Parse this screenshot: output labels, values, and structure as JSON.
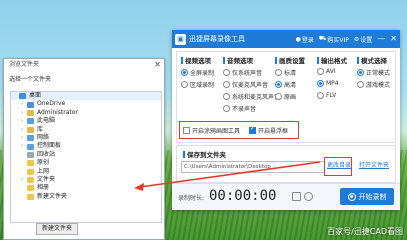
{
  "colors": {
    "accent": "#1e7bd8",
    "highlight": "#e23b2e"
  },
  "dialog": {
    "title": "浏览文件夹",
    "close_icon": "close-icon",
    "prompt": "选择一个文件夹",
    "tree": [
      {
        "label": "桌面",
        "icon": "desktop-icon",
        "color": "#3a8ee6",
        "indent": 0,
        "expander": ""
      },
      {
        "label": "OneDrive",
        "icon": "cloud-icon",
        "color": "#4a90d9",
        "indent": 1,
        "expander": "›"
      },
      {
        "label": "Administrator",
        "icon": "user-folder-icon",
        "color": "#e6b84a",
        "indent": 1,
        "expander": "›"
      },
      {
        "label": "此电脑",
        "icon": "computer-icon",
        "color": "#5aa0e0",
        "indent": 1,
        "expander": "›"
      },
      {
        "label": "库",
        "icon": "library-icon",
        "color": "#e6b84a",
        "indent": 1,
        "expander": "›"
      },
      {
        "label": "网络",
        "icon": "network-icon",
        "color": "#5aa0e0",
        "indent": 1,
        "expander": "›"
      },
      {
        "label": "控制面板",
        "icon": "control-panel-icon",
        "color": "#5aa0e0",
        "indent": 1,
        "expander": "›"
      },
      {
        "label": "回收站",
        "icon": "recycle-bin-icon",
        "color": "#9aa",
        "indent": 1,
        "expander": ""
      },
      {
        "label": "原创",
        "icon": "folder-icon",
        "color": "#f0c64e",
        "indent": 1,
        "expander": ""
      },
      {
        "label": "上网",
        "icon": "folder-icon",
        "color": "#f0c64e",
        "indent": 1,
        "expander": ""
      },
      {
        "label": "文件夹",
        "icon": "folder-icon",
        "color": "#f0c64e",
        "indent": 1,
        "expander": "›"
      },
      {
        "label": "相册",
        "icon": "folder-icon",
        "color": "#f0c64e",
        "indent": 1,
        "expander": ""
      },
      {
        "label": "新建文件夹",
        "icon": "folder-icon",
        "color": "#f0c64e",
        "indent": 1,
        "expander": ""
      }
    ],
    "new_folder_button": "新建文件夹"
  },
  "app": {
    "title": "迅捷屏幕录像工具",
    "header": {
      "login": "登录",
      "buy_vip": "购买VIP",
      "settings": "设置",
      "minimize": "—",
      "close": "✕"
    },
    "columns": {
      "video": {
        "title": "视频选项",
        "options": [
          {
            "label": "全屏录制",
            "selected": true
          },
          {
            "label": "区域录制",
            "selected": false
          }
        ]
      },
      "audio": {
        "title": "音频选项",
        "options": [
          {
            "label": "仅系统声音",
            "selected": false
          },
          {
            "label": "仅麦克风声音",
            "selected": false
          },
          {
            "label": "系统和麦克风声音",
            "selected": false
          },
          {
            "label": "不录声音",
            "selected": false
          }
        ]
      },
      "quality": {
        "title": "画质设置",
        "options": [
          {
            "label": "标清",
            "selected": false
          },
          {
            "label": "高清",
            "selected": true
          },
          {
            "label": "原画",
            "selected": false
          }
        ]
      },
      "format": {
        "title": "输出格式",
        "options": [
          {
            "label": "AVI",
            "selected": false
          },
          {
            "label": "MP4",
            "selected": true
          },
          {
            "label": "FLV",
            "selected": false
          }
        ]
      },
      "mode": {
        "title": "模式选择",
        "options": [
          {
            "label": "正常模式",
            "selected": true
          },
          {
            "label": "游戏模式",
            "selected": false
          }
        ]
      }
    },
    "checks": {
      "open_draw_tool": {
        "label": "开启涂鸦画图工具",
        "checked": false
      },
      "floating_window": {
        "label": "开启悬浮框",
        "checked": true
      }
    },
    "save": {
      "title": "保存到文件夹",
      "path": "C:\\Users\\Administrator\\Desktop",
      "change_dir": "更改目录",
      "open_folder": "打开文件夹"
    },
    "bottom": {
      "rec_label": "录制时长:",
      "time": "00:00:00",
      "start_button": "开始录制"
    }
  },
  "watermark": "百家号/迅捷CAD看图"
}
